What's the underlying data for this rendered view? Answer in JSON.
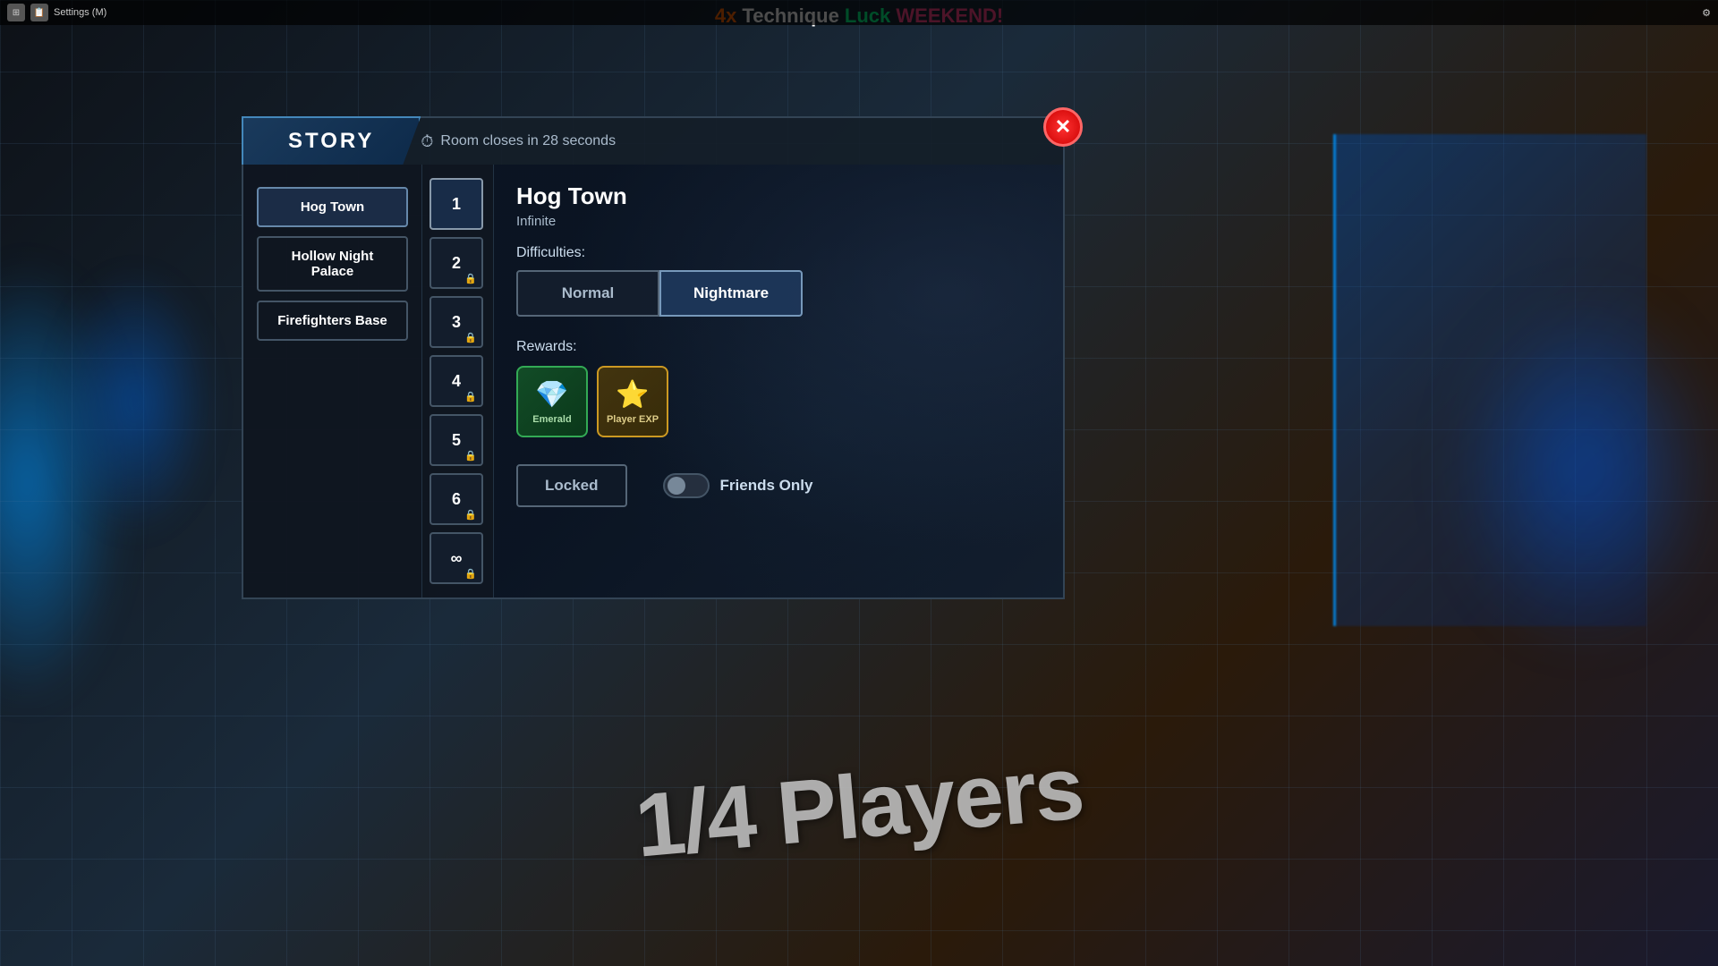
{
  "topBanner": {
    "text_4x": "4x",
    "text_technique": " Technique ",
    "text_luck": "Luck",
    "text_weekend": " WEEKEND!"
  },
  "osBar": {
    "settingsLabel": "Settings (M)",
    "rightIcon": "⚙"
  },
  "modal": {
    "storyTab": "STORY",
    "timerText": "Room closes in 28 seconds",
    "closeLabel": "✕",
    "locations": [
      {
        "id": "hog-town",
        "label": "Hog Town",
        "active": true
      },
      {
        "id": "hollow-night",
        "label": "Hollow Night Palace",
        "active": false
      },
      {
        "id": "firefighters",
        "label": "Firefighters Base",
        "active": false
      }
    ],
    "levels": [
      {
        "num": "1",
        "locked": false,
        "active": true
      },
      {
        "num": "2",
        "locked": true,
        "active": false
      },
      {
        "num": "3",
        "locked": true,
        "active": false
      },
      {
        "num": "4",
        "locked": true,
        "active": false
      },
      {
        "num": "5",
        "locked": true,
        "active": false
      },
      {
        "num": "6",
        "locked": true,
        "active": false
      },
      {
        "num": "∞",
        "locked": true,
        "active": false
      }
    ],
    "detail": {
      "title": "Hog Town",
      "subtitle": "Infinite",
      "difficultiesLabel": "Difficulties:",
      "difficulties": [
        {
          "id": "normal",
          "label": "Normal",
          "active": false
        },
        {
          "id": "nightmare",
          "label": "Nightmare",
          "active": true
        }
      ],
      "rewardsLabel": "Rewards:",
      "rewards": [
        {
          "id": "emerald",
          "icon": "💎",
          "name": "Emerald",
          "type": "gem"
        },
        {
          "id": "player-exp",
          "icon": "⭐",
          "name": "Player EXP",
          "type": "exp"
        }
      ],
      "lockedBtn": "Locked",
      "friendsLabel": "Friends Only",
      "friendsToggle": false
    }
  },
  "playersText": "1/4 Players",
  "icons": {
    "clock": "⏱",
    "lock": "🔒"
  }
}
